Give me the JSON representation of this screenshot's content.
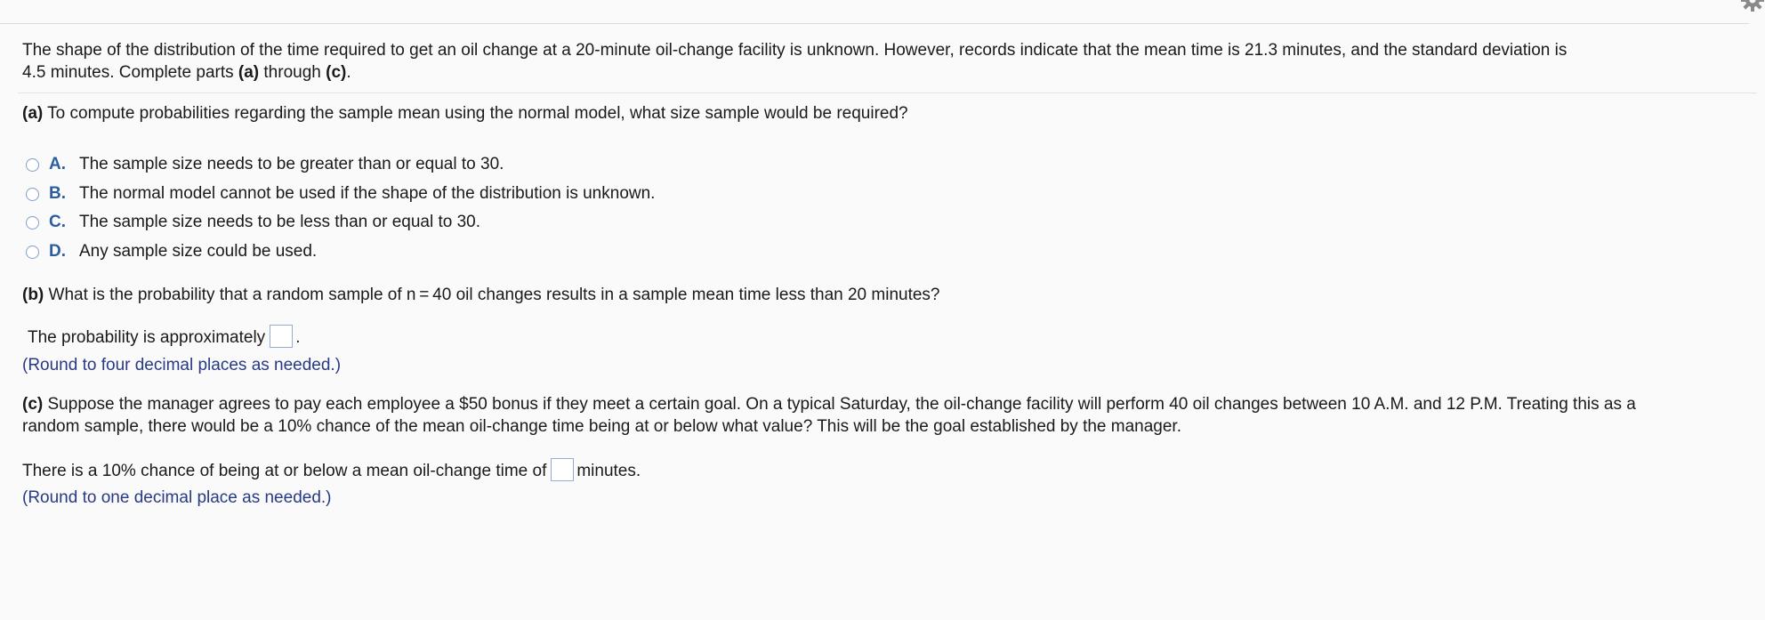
{
  "intro": {
    "line1": "The shape of the distribution of the time required to get an oil change at a 20-minute oil-change facility is unknown. However, records indicate that the mean time is 21.3 minutes, and the standard deviation is",
    "line2_prefix": "4.5 minutes. Complete parts ",
    "part_a_ref": "(a)",
    "through": " through ",
    "part_c_ref": "(c)",
    "period": "."
  },
  "part_a": {
    "label": "(a)",
    "question": " To compute probabilities regarding the sample mean using the normal model, what size sample would be required?",
    "options": [
      {
        "letter": "A.",
        "text": "The sample size needs to be greater than or equal to 30."
      },
      {
        "letter": "B.",
        "text": "The normal model cannot be used if the shape of the distribution is unknown."
      },
      {
        "letter": "C.",
        "text": "The sample size needs to be less than or equal to 30."
      },
      {
        "letter": "D.",
        "text": "Any sample size could be used."
      }
    ]
  },
  "part_b": {
    "label": "(b)",
    "question": " What is the probability that a random sample of n = 40 oil changes results in a sample mean time less than 20 minutes?",
    "answer_prefix": "The probability is approximately",
    "answer_suffix": ".",
    "answer_value": "",
    "hint": "(Round to four decimal places as needed.)"
  },
  "part_c": {
    "label": "(c)",
    "question_line1": " Suppose the manager agrees to pay each employee a $50 bonus if they meet a certain goal. On a typical Saturday, the oil-change facility will perform 40 oil changes between 10 A.M. and 12 P.M. Treating this as a",
    "question_line2": "random sample, there would be a 10% chance of the mean oil-change time being at or below what value? This will be the goal established by the manager.",
    "answer_prefix": "There is a 10% chance of being at or below a mean oil-change time of",
    "answer_suffix": "minutes.",
    "answer_value": "",
    "hint": "(Round to one decimal place as needed.)"
  },
  "icons": {
    "settings": "gear-icon"
  }
}
